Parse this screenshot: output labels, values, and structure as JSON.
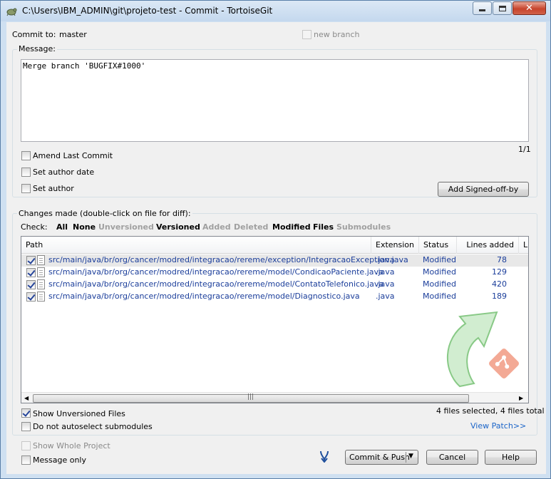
{
  "window": {
    "title": "C:\\Users\\IBM_ADMIN\\git\\projeto-test - Commit - TortoiseGit"
  },
  "commit_to": {
    "label": "Commit to:",
    "branch": "master",
    "new_branch_label": "new branch"
  },
  "message": {
    "group_label": "Message:",
    "text": "Merge branch 'BUGFIX#1000'",
    "counter": "1/1"
  },
  "options": {
    "amend": "Amend Last Commit",
    "set_author_date": "Set author date",
    "set_author": "Set author",
    "add_signed_off": "Add Signed-off-by"
  },
  "changes": {
    "group_label": "Changes made (double-click on file for diff):",
    "check_label": "Check:",
    "filters": [
      {
        "label": "All",
        "enabled": true
      },
      {
        "label": "None",
        "enabled": true
      },
      {
        "label": "Unversioned",
        "enabled": false
      },
      {
        "label": "Versioned",
        "enabled": true
      },
      {
        "label": "Added",
        "enabled": false
      },
      {
        "label": "Deleted",
        "enabled": false
      },
      {
        "label": "Modified",
        "enabled": true
      },
      {
        "label": "Files",
        "enabled": true
      },
      {
        "label": "Submodules",
        "enabled": false
      }
    ],
    "columns": [
      "Path",
      "Extension",
      "Status",
      "Lines added",
      "Li"
    ],
    "rows": [
      {
        "path": "src/main/java/br/org/cancer/modred/integracao/rereme/exception/IntegracaoException.java",
        "ext": ".java",
        "status": "Modified",
        "lines_added": "78"
      },
      {
        "path": "src/main/java/br/org/cancer/modred/integracao/rereme/model/CondicaoPaciente.java",
        "ext": ".java",
        "status": "Modified",
        "lines_added": "129"
      },
      {
        "path": "src/main/java/br/org/cancer/modred/integracao/rereme/model/ContatoTelefonico.java",
        "ext": ".java",
        "status": "Modified",
        "lines_added": "420"
      },
      {
        "path": "src/main/java/br/org/cancer/modred/integracao/rereme/model/Diagnostico.java",
        "ext": ".java",
        "status": "Modified",
        "lines_added": "189"
      }
    ],
    "scroll_grip": "|||",
    "summary": "4 files selected, 4 files total",
    "show_unversioned": "Show Unversioned Files",
    "no_autoselect": "Do not autoselect submodules",
    "view_patch": "View Patch>>"
  },
  "footer": {
    "show_whole_project": "Show Whole Project",
    "message_only": "Message only",
    "commit_push": "Commit & Push",
    "cancel": "Cancel",
    "help": "Help"
  }
}
